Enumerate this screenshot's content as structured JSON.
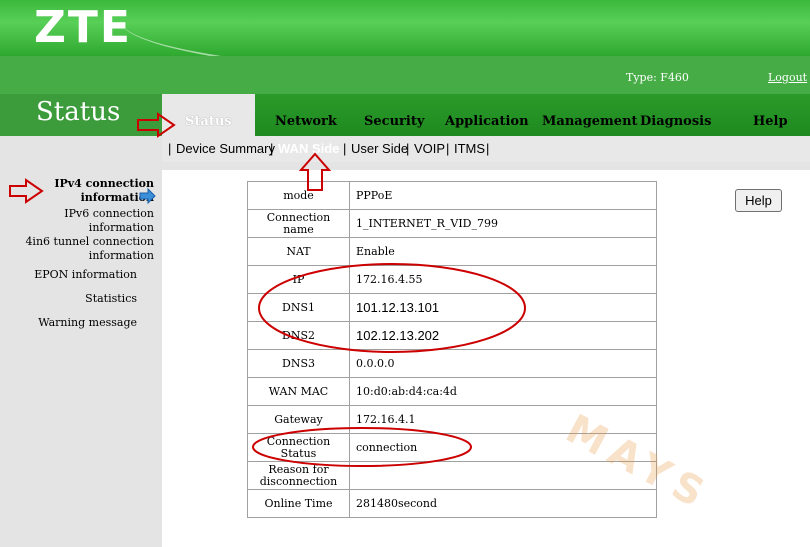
{
  "header": {
    "logo": "ZTE",
    "type_label": "Type: F460",
    "logout": "Logout"
  },
  "page_title": "Status",
  "nav": {
    "items": [
      "Status",
      "Network",
      "Security",
      "Application",
      "Management",
      "Diagnosis",
      "Help"
    ],
    "active": "Status"
  },
  "subnav": {
    "items": [
      "Device Summary",
      "WAN Side",
      "User Side",
      "VOIP",
      "ITMS"
    ],
    "separator": "|",
    "active": "WAN Side"
  },
  "sidebar": {
    "items": [
      {
        "line1": "IPv4 connection",
        "line2": "information",
        "active": true
      },
      {
        "line1": "IPv6 connection",
        "line2": "information",
        "active": false
      },
      {
        "line1": "4in6 tunnel connection",
        "line2": "information",
        "active": false
      },
      {
        "line1": "EPON information",
        "line2": "",
        "active": false
      },
      {
        "line1": "Statistics",
        "line2": "",
        "active": false
      },
      {
        "line1": "Warning message",
        "line2": "",
        "active": false
      }
    ]
  },
  "info_table": {
    "rows": [
      {
        "label": "mode",
        "value": "PPPoE"
      },
      {
        "label": "Connection name",
        "value": "1_INTERNET_R_VID_799"
      },
      {
        "label": "NAT",
        "value": "Enable"
      },
      {
        "label": "IP",
        "value": "172.16.4.55"
      },
      {
        "label": "DNS1",
        "value": "101.12.13.101"
      },
      {
        "label": "DNS2",
        "value": "102.12.13.202"
      },
      {
        "label": "DNS3",
        "value": "0.0.0.0"
      },
      {
        "label": "WAN MAC",
        "value": "10:d0:ab:d4:ca:4d"
      },
      {
        "label": "Gateway",
        "value": "172.16.4.1"
      },
      {
        "label": "Connection Status",
        "value": "connection"
      },
      {
        "label": "Reason for disconnection",
        "value": ""
      },
      {
        "label": "Online Time",
        "value": "281480second"
      }
    ]
  },
  "help_button": "Help",
  "watermark": "MAYS",
  "colors": {
    "banner_green": "#3cb83c",
    "nav_green": "#1f8a1f",
    "annotation_red": "#cc0000"
  }
}
